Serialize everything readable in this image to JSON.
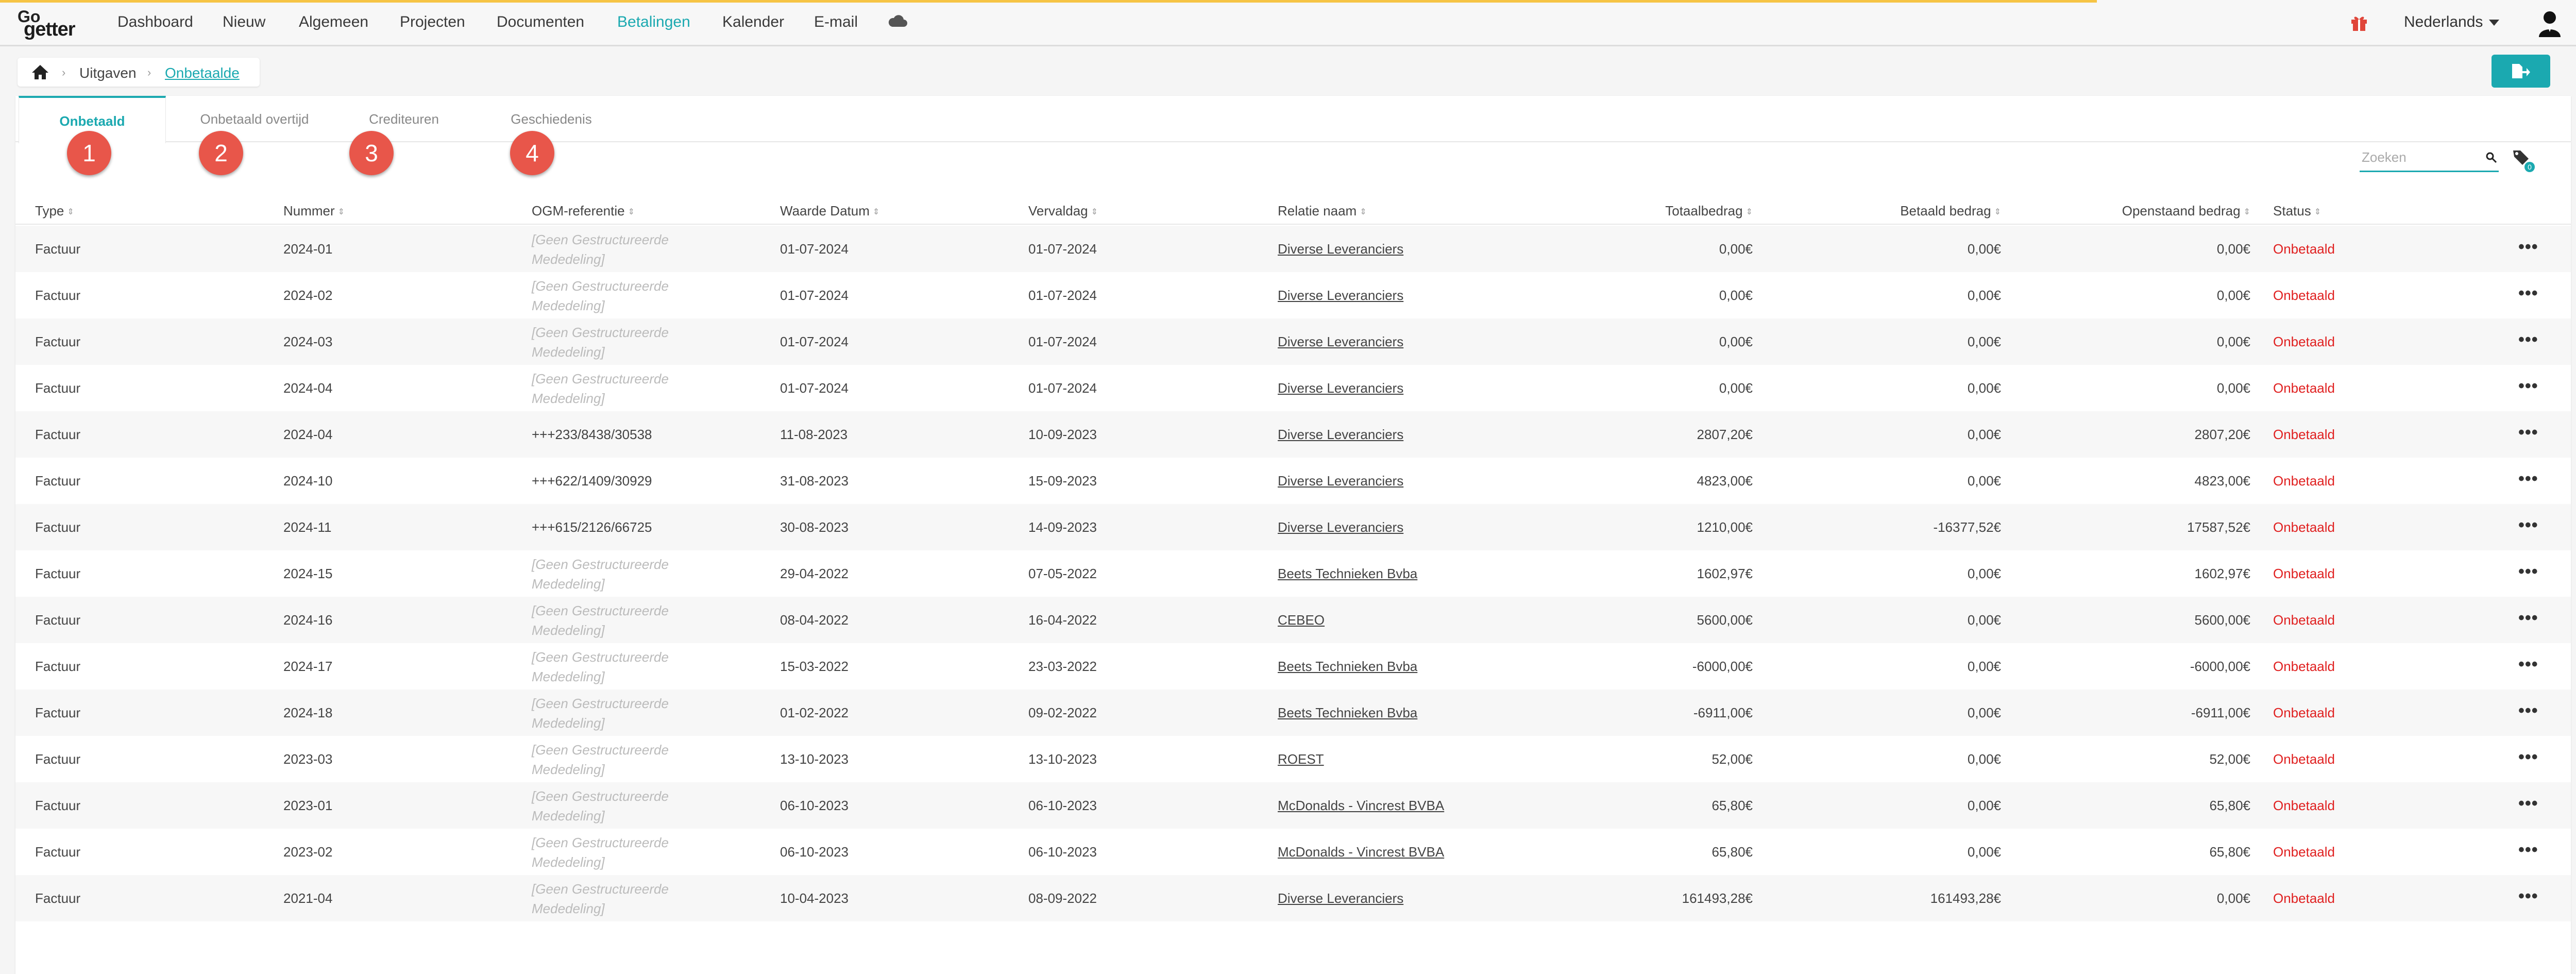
{
  "nav": {
    "logo_top": "Go",
    "logo_bottom": "getter",
    "items": [
      "Dashboard",
      "Nieuw",
      "Algemeen",
      "Projecten",
      "Documenten",
      "Betalingen",
      "Kalender",
      "E-mail"
    ],
    "active_item": "Betalingen",
    "language": "Nederlands",
    "accent_color": "#1ba9b0"
  },
  "breadcrumb": {
    "home_icon": "home-icon",
    "items": [
      "Uitgaven",
      "Onbetaalde"
    ]
  },
  "tabs": [
    {
      "label": "Onbetaald",
      "badge": "1"
    },
    {
      "label": "Onbetaald overtijd",
      "badge": "2"
    },
    {
      "label": "Crediteuren",
      "badge": "3"
    },
    {
      "label": "Geschiedenis",
      "badge": "4"
    }
  ],
  "search": {
    "placeholder": "Zoeken",
    "value": ""
  },
  "tag_count": "0",
  "table": {
    "columns": [
      "Type",
      "Nummer",
      "OGM-referentie",
      "Waarde Datum",
      "Vervaldag",
      "Relatie naam",
      "Totaalbedrag",
      "Betaald bedrag",
      "Openstaand bedrag",
      "Status"
    ],
    "ogm_placeholder": "[Geen Gestructureerde Mededeling]",
    "rows": [
      {
        "type": "Factuur",
        "nummer": "2024-01",
        "ogm": "",
        "waarde": "01-07-2024",
        "verval": "01-07-2024",
        "relatie": "Diverse Leveranciers",
        "totaal": "0,00€",
        "betaald": "0,00€",
        "open": "0,00€",
        "status": "Onbetaald"
      },
      {
        "type": "Factuur",
        "nummer": "2024-02",
        "ogm": "",
        "waarde": "01-07-2024",
        "verval": "01-07-2024",
        "relatie": "Diverse Leveranciers",
        "totaal": "0,00€",
        "betaald": "0,00€",
        "open": "0,00€",
        "status": "Onbetaald"
      },
      {
        "type": "Factuur",
        "nummer": "2024-03",
        "ogm": "",
        "waarde": "01-07-2024",
        "verval": "01-07-2024",
        "relatie": "Diverse Leveranciers",
        "totaal": "0,00€",
        "betaald": "0,00€",
        "open": "0,00€",
        "status": "Onbetaald"
      },
      {
        "type": "Factuur",
        "nummer": "2024-04",
        "ogm": "",
        "waarde": "01-07-2024",
        "verval": "01-07-2024",
        "relatie": "Diverse Leveranciers",
        "totaal": "0,00€",
        "betaald": "0,00€",
        "open": "0,00€",
        "status": "Onbetaald"
      },
      {
        "type": "Factuur",
        "nummer": "2024-04",
        "ogm": "+++233/8438/30538",
        "waarde": "11-08-2023",
        "verval": "10-09-2023",
        "relatie": "Diverse Leveranciers",
        "totaal": "2807,20€",
        "betaald": "0,00€",
        "open": "2807,20€",
        "status": "Onbetaald"
      },
      {
        "type": "Factuur",
        "nummer": "2024-10",
        "ogm": "+++622/1409/30929",
        "waarde": "31-08-2023",
        "verval": "15-09-2023",
        "relatie": "Diverse Leveranciers",
        "totaal": "4823,00€",
        "betaald": "0,00€",
        "open": "4823,00€",
        "status": "Onbetaald"
      },
      {
        "type": "Factuur",
        "nummer": "2024-11",
        "ogm": "+++615/2126/66725",
        "waarde": "30-08-2023",
        "verval": "14-09-2023",
        "relatie": "Diverse Leveranciers",
        "totaal": "1210,00€",
        "betaald": "-16377,52€",
        "open": "17587,52€",
        "status": "Onbetaald"
      },
      {
        "type": "Factuur",
        "nummer": "2024-15",
        "ogm": "",
        "waarde": "29-04-2022",
        "verval": "07-05-2022",
        "relatie": "Beets Technieken Bvba",
        "totaal": "1602,97€",
        "betaald": "0,00€",
        "open": "1602,97€",
        "status": "Onbetaald"
      },
      {
        "type": "Factuur",
        "nummer": "2024-16",
        "ogm": "",
        "waarde": "08-04-2022",
        "verval": "16-04-2022",
        "relatie": "CEBEO",
        "totaal": "5600,00€",
        "betaald": "0,00€",
        "open": "5600,00€",
        "status": "Onbetaald"
      },
      {
        "type": "Factuur",
        "nummer": "2024-17",
        "ogm": "",
        "waarde": "15-03-2022",
        "verval": "23-03-2022",
        "relatie": "Beets Technieken Bvba",
        "totaal": "-6000,00€",
        "betaald": "0,00€",
        "open": "-6000,00€",
        "status": "Onbetaald"
      },
      {
        "type": "Factuur",
        "nummer": "2024-18",
        "ogm": "",
        "waarde": "01-02-2022",
        "verval": "09-02-2022",
        "relatie": "Beets Technieken Bvba",
        "totaal": "-6911,00€",
        "betaald": "0,00€",
        "open": "-6911,00€",
        "status": "Onbetaald"
      },
      {
        "type": "Factuur",
        "nummer": "2023-03",
        "ogm": "",
        "waarde": "13-10-2023",
        "verval": "13-10-2023",
        "relatie": "ROEST",
        "totaal": "52,00€",
        "betaald": "0,00€",
        "open": "52,00€",
        "status": "Onbetaald"
      },
      {
        "type": "Factuur",
        "nummer": "2023-01",
        "ogm": "",
        "waarde": "06-10-2023",
        "verval": "06-10-2023",
        "relatie": "McDonalds - Vincrest BVBA",
        "totaal": "65,80€",
        "betaald": "0,00€",
        "open": "65,80€",
        "status": "Onbetaald"
      },
      {
        "type": "Factuur",
        "nummer": "2023-02",
        "ogm": "",
        "waarde": "06-10-2023",
        "verval": "06-10-2023",
        "relatie": "McDonalds - Vincrest BVBA",
        "totaal": "65,80€",
        "betaald": "0,00€",
        "open": "65,80€",
        "status": "Onbetaald"
      },
      {
        "type": "Factuur",
        "nummer": "2021-04",
        "ogm": "",
        "waarde": "10-04-2023",
        "verval": "08-09-2022",
        "relatie": "Diverse Leveranciers",
        "totaal": "161493,28€",
        "betaald": "161493,28€",
        "open": "0,00€",
        "status": "Onbetaald"
      }
    ],
    "row_action_icon": "more-dots-icon",
    "status_color": "#e02020"
  }
}
